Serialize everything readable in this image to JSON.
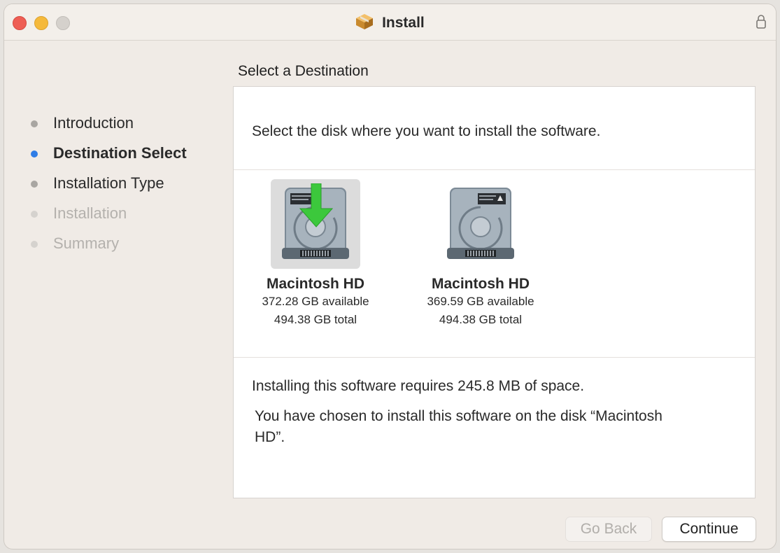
{
  "window": {
    "title": "Install"
  },
  "sidebar": {
    "steps": [
      {
        "label": "Introduction",
        "state": "done"
      },
      {
        "label": "Destination Select",
        "state": "active"
      },
      {
        "label": "Installation Type",
        "state": "done"
      },
      {
        "label": "Installation",
        "state": "future"
      },
      {
        "label": "Summary",
        "state": "future"
      }
    ]
  },
  "main": {
    "heading": "Select a Destination",
    "prompt": "Select the disk where you want to install the  software.",
    "disks": [
      {
        "name": "Macintosh HD",
        "available": "372.28 GB available",
        "total": "494.38 GB total",
        "selected": true
      },
      {
        "name": "Macintosh HD",
        "available": "369.59 GB available",
        "total": "494.38 GB total",
        "selected": false
      }
    ],
    "requirement": "Installing this software requires 245.8 MB of space.",
    "chosen": "You have chosen to install this software on the disk “Macintosh HD”."
  },
  "buttons": {
    "back": "Go Back",
    "continue": "Continue"
  },
  "colors": {
    "accent": "#2f7de6",
    "close": "#ee5e54",
    "minimize": "#f5b93b",
    "arrow": "#3cc83c"
  }
}
